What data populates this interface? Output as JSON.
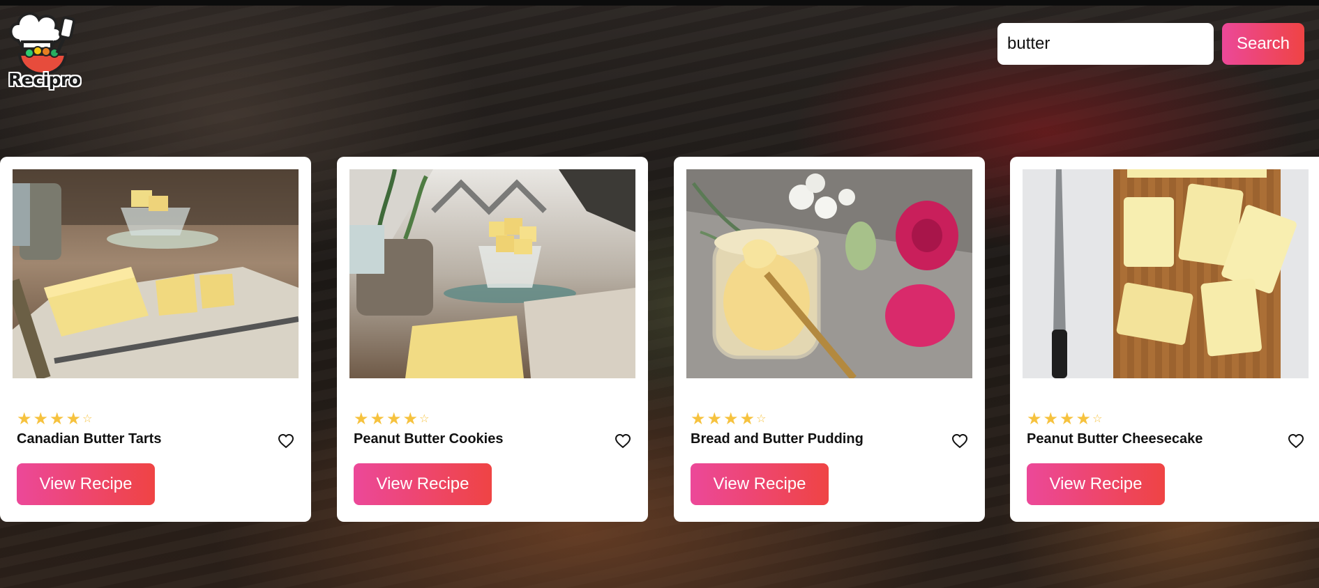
{
  "app": {
    "logo_text": "Recipro"
  },
  "search": {
    "value": "butter",
    "button_label": "Search"
  },
  "colors": {
    "accent_start": "#ec4899",
    "accent_end": "#ef4444",
    "star": "#f6c23e"
  },
  "results": [
    {
      "title": "Canadian Butter Tarts",
      "rating": 4,
      "max_rating": 5,
      "button_label": "View Recipe",
      "favorite_icon": "heart-outline-icon"
    },
    {
      "title": "Peanut Butter Cookies",
      "rating": 4,
      "max_rating": 5,
      "button_label": "View Recipe",
      "favorite_icon": "heart-outline-icon"
    },
    {
      "title": "Bread and Butter Pudding",
      "rating": 4,
      "max_rating": 5,
      "button_label": "View Recipe",
      "favorite_icon": "heart-outline-icon"
    },
    {
      "title": "Peanut Butter Cheesecake",
      "rating": 4,
      "max_rating": 5,
      "button_label": "View Recipe",
      "favorite_icon": "heart-outline-icon"
    }
  ]
}
